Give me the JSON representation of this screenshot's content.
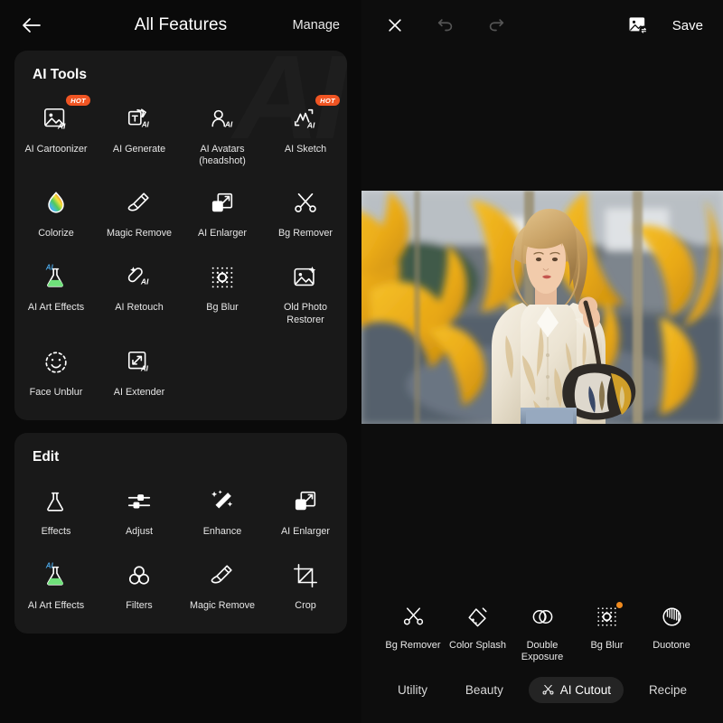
{
  "left": {
    "header": {
      "back_icon": "arrow-left-icon",
      "title": "All Features",
      "manage_label": "Manage"
    },
    "watermark": "AI",
    "sections": [
      {
        "id": "ai-tools",
        "title": "AI Tools",
        "items": [
          {
            "label": "AI Cartoonizer",
            "icon": "image-ai-icon",
            "badge": "HOT"
          },
          {
            "label": "AI Generate",
            "icon": "text-cards-ai-icon",
            "badge": ""
          },
          {
            "label": "AI Avatars\n(headshot)",
            "icon": "person-ai-icon",
            "badge": ""
          },
          {
            "label": "AI Sketch",
            "icon": "sketch-ai-icon",
            "badge": "HOT"
          },
          {
            "label": "Colorize",
            "icon": "rainbow-droplet-icon",
            "badge": ""
          },
          {
            "label": "Magic Remove",
            "icon": "eraser-pencil-icon",
            "badge": ""
          },
          {
            "label": "AI Enlarger",
            "icon": "expand-square-icon",
            "badge": ""
          },
          {
            "label": "Bg Remover",
            "icon": "scissors-icon",
            "badge": ""
          },
          {
            "label": "AI Art Effects",
            "icon": "flask-ai-icon",
            "badge": ""
          },
          {
            "label": "AI Retouch",
            "icon": "retouch-ai-icon",
            "badge": ""
          },
          {
            "label": "Bg Blur",
            "icon": "dots-aperture-icon",
            "badge": ""
          },
          {
            "label": "Old Photo Restorer",
            "icon": "photo-sparkle-icon",
            "badge": ""
          },
          {
            "label": "Face Unblur",
            "icon": "dashed-smiley-icon",
            "badge": ""
          },
          {
            "label": "AI Extender",
            "icon": "extend-ai-icon",
            "badge": ""
          }
        ]
      },
      {
        "id": "edit",
        "title": "Edit",
        "items": [
          {
            "label": "Effects",
            "icon": "flask-icon",
            "badge": ""
          },
          {
            "label": "Adjust",
            "icon": "sliders-icon",
            "badge": ""
          },
          {
            "label": "Enhance",
            "icon": "magic-wand-icon",
            "badge": ""
          },
          {
            "label": "AI Enlarger",
            "icon": "expand-square-icon",
            "badge": ""
          },
          {
            "label": "AI Art Effects",
            "icon": "flask-ai-icon",
            "badge": ""
          },
          {
            "label": "Filters",
            "icon": "three-circles-icon",
            "badge": ""
          },
          {
            "label": "Magic Remove",
            "icon": "eraser-pencil-icon",
            "badge": ""
          },
          {
            "label": "Crop",
            "icon": "crop-icon",
            "badge": ""
          }
        ]
      }
    ]
  },
  "right": {
    "header": {
      "close_icon": "close-icon",
      "undo_icon": "undo-icon",
      "redo_icon": "redo-icon",
      "replace_icon": "image-swap-icon",
      "save_label": "Save"
    },
    "tools": [
      {
        "label": "Bg Remover",
        "icon": "scissors-icon",
        "dot": false
      },
      {
        "label": "Color Splash",
        "icon": "paint-bucket-icon",
        "dot": false
      },
      {
        "label": "Double\nExposure",
        "icon": "venn-circles-icon",
        "dot": false
      },
      {
        "label": "Bg Blur",
        "icon": "dots-aperture-icon",
        "dot": true
      },
      {
        "label": "Duotone",
        "icon": "duotone-circle-icon",
        "dot": false
      }
    ],
    "tabs": [
      {
        "label": "Utility",
        "active": false,
        "icon": ""
      },
      {
        "label": "Beauty",
        "active": false,
        "icon": ""
      },
      {
        "label": "AI Cutout",
        "active": true,
        "icon": "scissors-icon"
      },
      {
        "label": "Recipe",
        "active": false,
        "icon": ""
      }
    ]
  },
  "colors": {
    "accent_orange": "#f05523",
    "dot_orange": "#f08a1e",
    "card_bg": "#191919",
    "page_bg": "#0a0a0a",
    "active_tab_bg": "#242424",
    "ai_blue": "#4aa3e0",
    "flask_green": "#6fe07a"
  }
}
